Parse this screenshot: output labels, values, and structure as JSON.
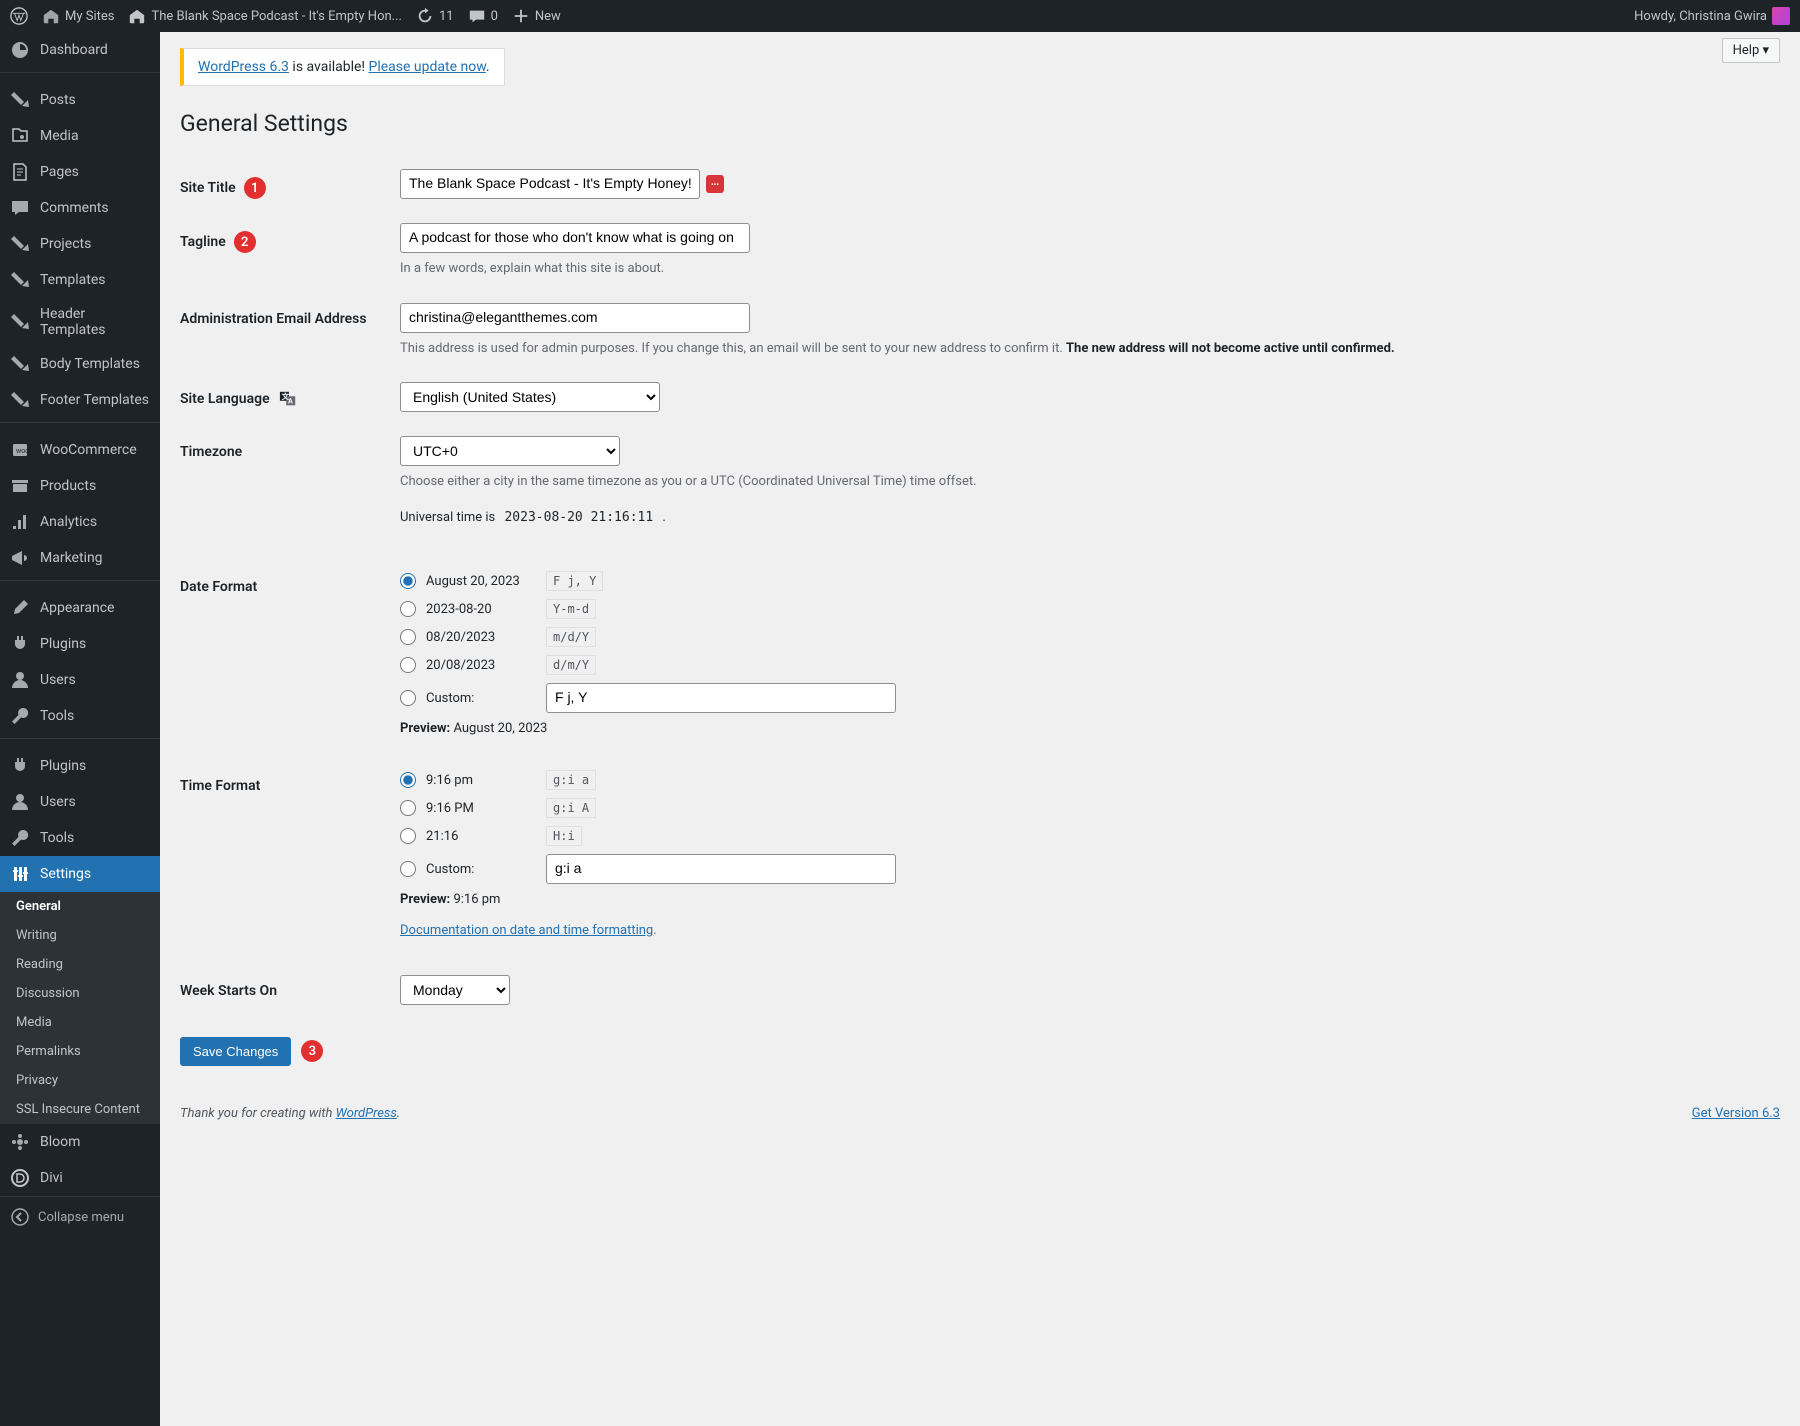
{
  "adminbar": {
    "my_sites": "My Sites",
    "site_title": "The Blank Space Podcast - It's Empty Hon...",
    "updates": "11",
    "comments": "0",
    "new": "New",
    "howdy": "Howdy, Christina Gwira"
  },
  "sidebar": {
    "items": [
      {
        "label": "Dashboard",
        "icon": "dashicons-dashboard"
      },
      {
        "label": "Posts",
        "icon": "dashicons-admin-post"
      },
      {
        "label": "Media",
        "icon": "dashicons-admin-media"
      },
      {
        "label": "Pages",
        "icon": "dashicons-admin-page"
      },
      {
        "label": "Comments",
        "icon": "dashicons-admin-comments"
      },
      {
        "label": "Projects",
        "icon": "dashicons-admin-post"
      },
      {
        "label": "Templates",
        "icon": "dashicons-admin-post"
      },
      {
        "label": "Header Templates",
        "icon": "dashicons-admin-post"
      },
      {
        "label": "Body Templates",
        "icon": "dashicons-admin-post"
      },
      {
        "label": "Footer Templates",
        "icon": "dashicons-admin-post"
      },
      {
        "label": "WooCommerce",
        "icon": "dashicons-cart"
      },
      {
        "label": "Products",
        "icon": "dashicons-archive"
      },
      {
        "label": "Analytics",
        "icon": "dashicons-chart-bar"
      },
      {
        "label": "Marketing",
        "icon": "dashicons-megaphone"
      },
      {
        "label": "Appearance",
        "icon": "dashicons-admin-appearance"
      },
      {
        "label": "Plugins",
        "icon": "dashicons-admin-plugins"
      },
      {
        "label": "Users",
        "icon": "dashicons-admin-users"
      },
      {
        "label": "Tools",
        "icon": "dashicons-admin-tools"
      },
      {
        "label": "Plugins",
        "icon": "dashicons-admin-plugins"
      },
      {
        "label": "Users",
        "icon": "dashicons-admin-users"
      },
      {
        "label": "Tools",
        "icon": "dashicons-admin-tools"
      },
      {
        "label": "Settings",
        "icon": "dashicons-admin-settings",
        "current": true
      }
    ],
    "submenu": [
      {
        "label": "General",
        "current": true
      },
      {
        "label": "Writing"
      },
      {
        "label": "Reading"
      },
      {
        "label": "Discussion"
      },
      {
        "label": "Media"
      },
      {
        "label": "Permalinks"
      },
      {
        "label": "Privacy"
      },
      {
        "label": "SSL Insecure Content"
      }
    ],
    "after": [
      {
        "label": "Bloom",
        "icon": "dashicons-bloom"
      },
      {
        "label": "Divi",
        "icon": "dashicons-divi"
      }
    ],
    "collapse": "Collapse menu"
  },
  "help": "Help ▾",
  "notice": {
    "prefix": "WordPress 6.3",
    "middle": " is available! ",
    "link": "Please update now",
    "suffix": "."
  },
  "page_title": "General Settings",
  "form": {
    "site_title": {
      "label": "Site Title",
      "value": "The Blank Space Podcast - It's Empty Honey!",
      "badge": "1"
    },
    "tagline": {
      "label": "Tagline",
      "value": "A podcast for those who don't know what is going on",
      "desc": "In a few words, explain what this site is about.",
      "badge": "2"
    },
    "admin_email": {
      "label": "Administration Email Address",
      "value": "christina@elegantthemes.com",
      "desc_a": "This address is used for admin purposes. If you change this, an email will be sent to your new address to confirm it. ",
      "desc_b": "The new address will not become active until confirmed."
    },
    "site_language": {
      "label": "Site Language",
      "value": "English (United States)"
    },
    "timezone": {
      "label": "Timezone",
      "value": "UTC+0",
      "desc": "Choose either a city in the same timezone as you or a UTC (Coordinated Universal Time) time offset.",
      "utc_prefix": "Universal time is ",
      "utc_value": "2023-08-20 21:16:11",
      "utc_suffix": " ."
    },
    "date_format": {
      "label": "Date Format",
      "options": [
        {
          "display": "August 20, 2023",
          "code": "F j, Y",
          "checked": true
        },
        {
          "display": "2023-08-20",
          "code": "Y-m-d"
        },
        {
          "display": "08/20/2023",
          "code": "m/d/Y"
        },
        {
          "display": "20/08/2023",
          "code": "d/m/Y"
        }
      ],
      "custom_label": "Custom:",
      "custom_value": "F j, Y",
      "preview_label": "Preview:",
      "preview_value": "August 20, 2023"
    },
    "time_format": {
      "label": "Time Format",
      "options": [
        {
          "display": "9:16 pm",
          "code": "g:i a",
          "checked": true
        },
        {
          "display": "9:16 PM",
          "code": "g:i A"
        },
        {
          "display": "21:16",
          "code": "H:i"
        }
      ],
      "custom_label": "Custom:",
      "custom_value": "g:i a",
      "preview_label": "Preview:",
      "preview_value": "9:16 pm",
      "doc_link": "Documentation on date and time formatting",
      "doc_suffix": "."
    },
    "week_starts": {
      "label": "Week Starts On",
      "value": "Monday"
    },
    "save": {
      "label": "Save Changes",
      "badge": "3"
    }
  },
  "footer": {
    "thankyou_prefix": "Thank you for creating with ",
    "thankyou_link": "WordPress",
    "thankyou_suffix": ".",
    "version": "Get Version 6.3"
  }
}
